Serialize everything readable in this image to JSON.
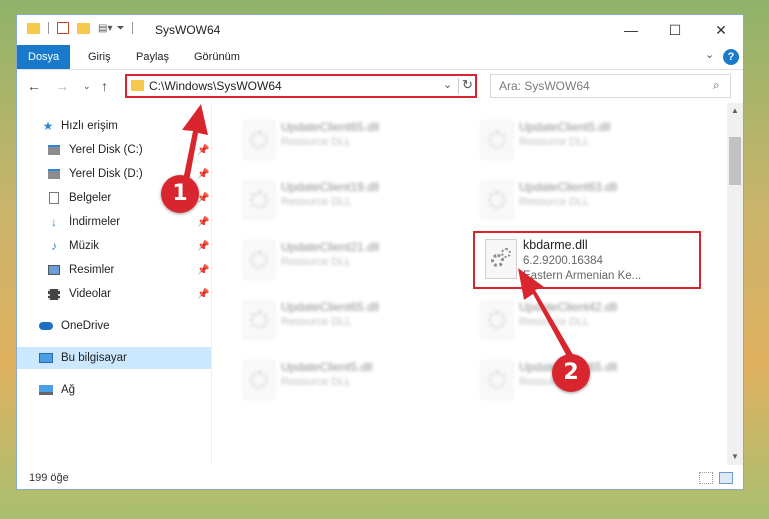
{
  "window": {
    "title": "SysWOW64",
    "controls": {
      "minimize": "—",
      "maximize": "☐",
      "close": "✕"
    }
  },
  "ribbon": {
    "tabs": [
      "Dosya",
      "Giriş",
      "Paylaş",
      "Görünüm"
    ],
    "help": "?"
  },
  "address": {
    "path": "C:\\Windows\\SysWOW64",
    "search_placeholder": "Ara: SysWOW64"
  },
  "nav_pane": {
    "quick_access": "Hızlı erişim",
    "items": [
      {
        "label": "Yerel Disk (C:)",
        "icon": "drive-icon"
      },
      {
        "label": "Yerel Disk (D:)",
        "icon": "drive-icon"
      },
      {
        "label": "Belgeler",
        "icon": "documents-icon"
      },
      {
        "label": "İndirmeler",
        "icon": "downloads-icon"
      },
      {
        "label": "Müzik",
        "icon": "music-icon"
      },
      {
        "label": "Resimler",
        "icon": "pictures-icon"
      },
      {
        "label": "Videolar",
        "icon": "videos-icon"
      }
    ],
    "onedrive": "OneDrive",
    "this_pc": "Bu bilgisayar",
    "network": "Ağ"
  },
  "files": [
    {
      "name": "UpdateClient65.dll",
      "type": "Resource DLL"
    },
    {
      "name": "UpdateClient5.dll",
      "type": "Resource DLL"
    },
    {
      "name": "UpdateClient19.dll",
      "type": "Resource DLL"
    },
    {
      "name": "UpdateClient63.dll",
      "type": "Resource DLL"
    },
    {
      "name": "UpdateClient21.dll",
      "type": "Resource DLL"
    },
    {
      "name": "UpdateClient65.dll",
      "type": "Resource DLL"
    },
    {
      "name": "UpdateClient42.dll",
      "type": "Resource DLL"
    },
    {
      "name": "UpdateClient5.dll",
      "type": "Resource DLL"
    },
    {
      "name": "UpdateClient65.dll",
      "type": "Resource DLL"
    }
  ],
  "highlighted_file": {
    "name": "kbdarme.dll",
    "version": "6.2.9200.16384",
    "description": "Eastern Armenian Ke..."
  },
  "status": {
    "item_count": "199 öğe"
  },
  "annotations": {
    "marker1": "1",
    "marker2": "2",
    "color": "#d9262e"
  }
}
